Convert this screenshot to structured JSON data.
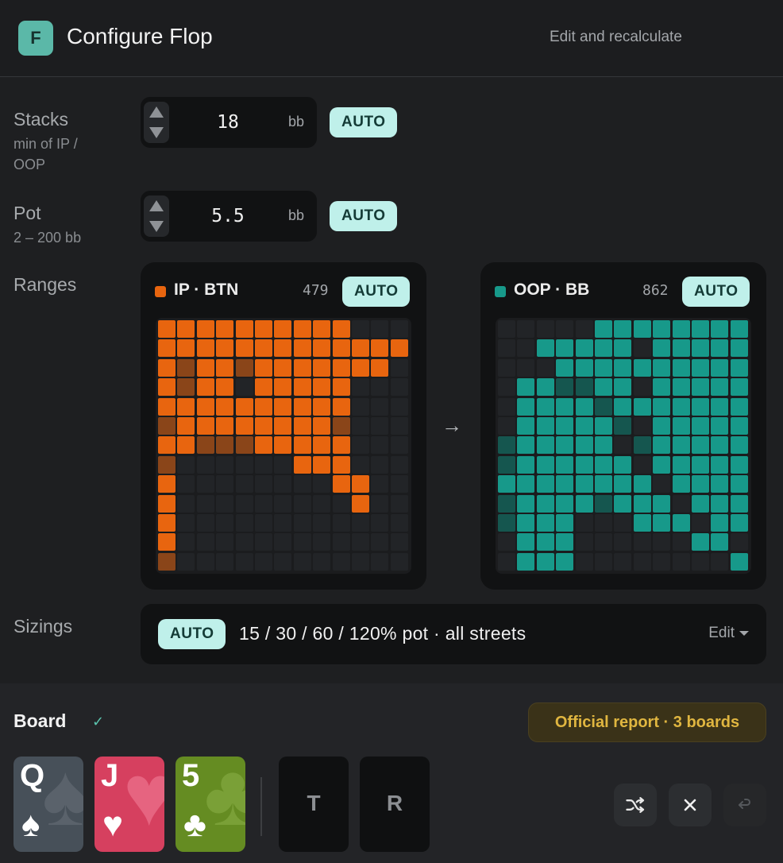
{
  "header": {
    "logo_letter": "F",
    "title": "Configure Flop",
    "recalc_label": "Edit and recalculate"
  },
  "stacks": {
    "label": "Stacks",
    "sublabel_1": "min of IP /",
    "sublabel_2": "OOP",
    "value": "18",
    "unit": "bb",
    "auto_label": "AUTO"
  },
  "pot": {
    "label": "Pot",
    "sublabel": "2 – 200 bb",
    "value": "5.5",
    "unit": "bb",
    "auto_label": "AUTO"
  },
  "ranges": {
    "label": "Ranges",
    "arrow": "→",
    "ip": {
      "name": "IP · BTN",
      "count": "479",
      "auto_label": "AUTO",
      "color": "#e8650f",
      "dim_color": "#8a4519",
      "grid": [
        "2222222222000",
        "2222222222222",
        "2122122222220",
        "2122022222000",
        "2222222222000",
        "1222222221000",
        "2211122222000",
        "1000000222000",
        "2000000002200",
        "2000000000200",
        "2000000000000",
        "2000000000000",
        "1000000000000"
      ]
    },
    "oop": {
      "name": "OOP · BB",
      "count": "862",
      "auto_label": "AUTO",
      "color": "#17998a",
      "dim_color": "#15564f",
      "grid": [
        "0000022222222",
        "0022222022222",
        "0002222222222",
        "0221122022222",
        "0222212222222",
        "0222221022222",
        "1222220122222",
        "1222222022222",
        "2222222202222",
        "1222212220222",
        "1222000222022",
        "0222000000220",
        "0222000000002"
      ]
    }
  },
  "sizings": {
    "label": "Sizings",
    "auto_label": "AUTO",
    "text": "15 / 30 / 60 / 120% pot · all streets",
    "edit_label": "Edit"
  },
  "board": {
    "label": "Board",
    "check": "✓",
    "report_label": "Official report · 3 boards",
    "cards": [
      {
        "rank": "Q",
        "suit": "♠",
        "suit_name": "spades",
        "color": "#475059",
        "bg_suit_color": "#5a626b"
      },
      {
        "rank": "J",
        "suit": "♥",
        "suit_name": "hearts",
        "color": "#d6405f",
        "bg_suit_color": "#e66480"
      },
      {
        "rank": "5",
        "suit": "♣",
        "suit_name": "clubs",
        "color": "#658c22",
        "bg_suit_color": "#7aa037"
      }
    ],
    "turn_label": "T",
    "river_label": "R"
  }
}
